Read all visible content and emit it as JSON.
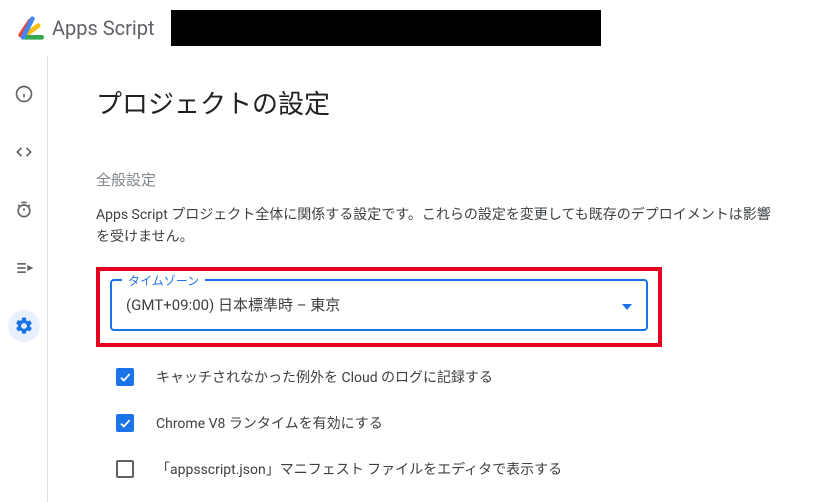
{
  "header": {
    "product_name": "Apps Script"
  },
  "sidebar": {
    "items": [
      {
        "name": "overview"
      },
      {
        "name": "editor"
      },
      {
        "name": "triggers"
      },
      {
        "name": "executions"
      },
      {
        "name": "settings"
      }
    ]
  },
  "main": {
    "page_title": "プロジェクトの設定",
    "general": {
      "label": "全般設定",
      "description": "Apps Script プロジェクト全体に関係する設定です。これらの設定を変更しても既存のデプロイメントは影響を受けません。"
    },
    "timezone": {
      "float_label": "タイムゾーン",
      "value": "(GMT+09:00) 日本標準時 – 東京"
    },
    "checkboxes": [
      {
        "checked": true,
        "label": "キャッチされなかった例外を Cloud のログに記録する"
      },
      {
        "checked": true,
        "label": "Chrome V8 ランタイムを有効にする"
      },
      {
        "checked": false,
        "label": "「appsscript.json」マニフェスト ファイルをエディタで表示する"
      }
    ]
  }
}
